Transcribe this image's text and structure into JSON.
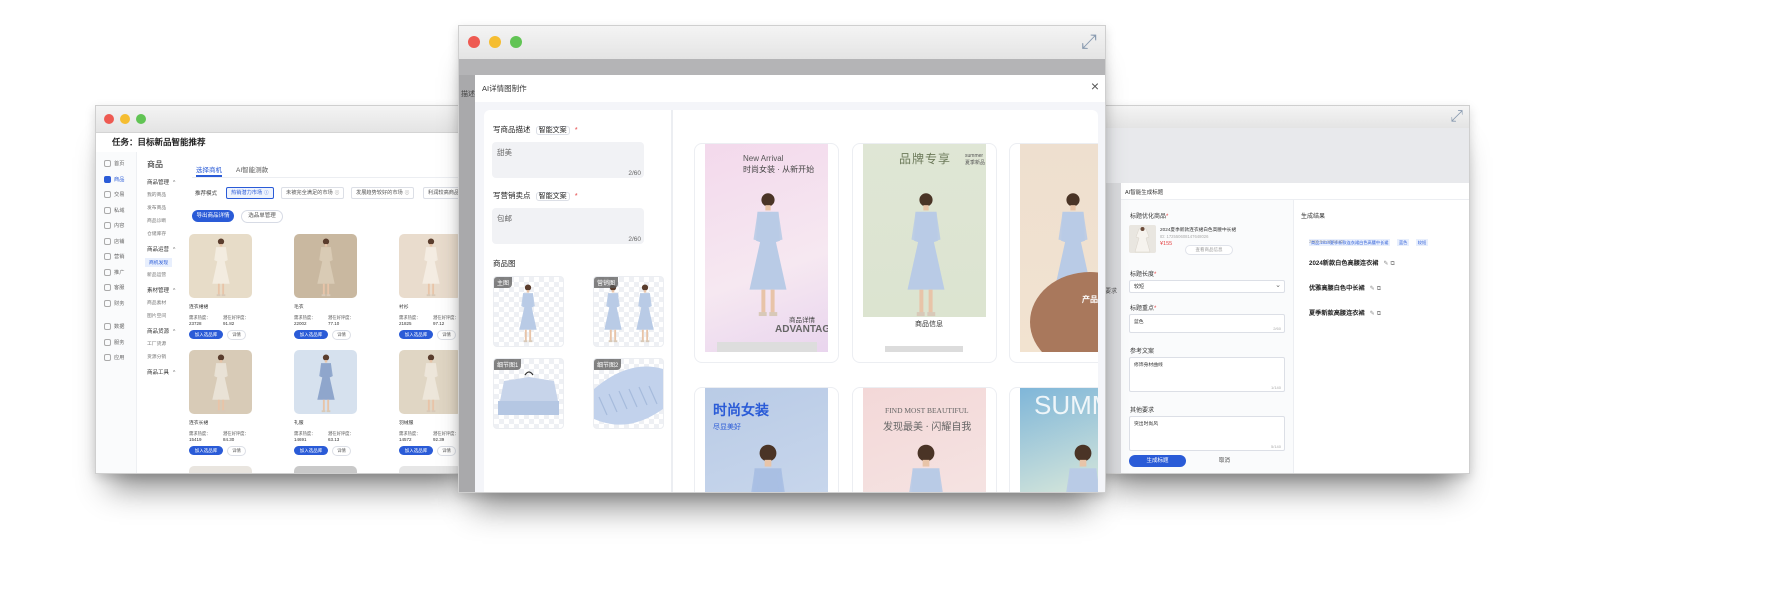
{
  "left_window": {
    "task_title": "任务：目标新品智能推荐",
    "sidebar": [
      "首页",
      "商品",
      "交易",
      "私域",
      "内容",
      "店铺",
      "营销",
      "推广",
      "客服",
      "财务",
      "数据",
      "服务",
      "应用"
    ],
    "nav_title": "商品",
    "nav_groups": [
      {
        "title": "商品管理",
        "items": [
          "我的商品",
          "发布商品",
          "商品诊断",
          "仓储库存"
        ]
      },
      {
        "title": "商品运营",
        "items": [
          "商机发现",
          "新品运营"
        ]
      },
      {
        "title": "素材管理",
        "items": [
          "商品素材",
          "图片空间"
        ]
      },
      {
        "title": "商品货源",
        "items": [
          "工厂货源",
          "货源分销"
        ]
      },
      {
        "title": "商品工具",
        "items": []
      }
    ],
    "tabs": [
      "选择商机",
      "AI智能测款"
    ],
    "filter_label": "推荐模式",
    "filters": [
      "热销潜力市场",
      "未被完全满足的市场",
      "发展趋势较好的市场",
      "利润较高商品"
    ],
    "primary_action": "导出商品详情",
    "secondary_action": "选品单管理",
    "products": [
      {
        "name": "连衣裙裙",
        "heat": "23728",
        "score": "91.82"
      },
      {
        "name": "毛衣",
        "heat": "22002",
        "score": "77.10"
      },
      {
        "name": "衬衫",
        "heat": "21825",
        "score": "97.12"
      },
      {
        "name": "连衣长裙",
        "heat": "15419",
        "score": "84.30"
      },
      {
        "name": "礼服",
        "heat": "14691",
        "score": "63.13"
      },
      {
        "name": "羽绒服",
        "heat": "14572",
        "score": "92.39"
      }
    ],
    "heat_label": "需求热度：",
    "score_label": "潜在好评度：",
    "add_label": "加入选品库",
    "detail_label": "详情"
  },
  "center_window": {
    "dialog_title": "AI详情图制作",
    "back_text": "描述",
    "desc_label": "写商品描述",
    "desc_ai": "智能文案",
    "desc_value": "甜美",
    "desc_count": "2/60",
    "selling_label": "写营销卖点",
    "selling_ai": "智能文案",
    "selling_value": "包邮",
    "selling_count": "2/60",
    "image_label": "商品图",
    "image_tags": [
      "主图",
      "营销图",
      "细节图1",
      "细节图2"
    ],
    "required_mark": "*",
    "close_icon": "×",
    "cards": [
      {
        "lines": [
          "New Arrival",
          "时尚女装 · 从新开始",
          "商品详情",
          "ADVANTAGE"
        ]
      },
      {
        "lines": [
          "品牌专享",
          "summer",
          "夏季新品",
          "商品信息",
          "甜美"
        ]
      },
      {
        "lines": [
          "夏",
          "产品信"
        ]
      },
      {
        "lines": [
          "时尚女装",
          "尽显美好"
        ]
      },
      {
        "lines": [
          "FIND MOST BEAUTIFUL",
          "发现最美 · 闪耀自我"
        ]
      },
      {
        "lines": [
          "SUMM"
        ]
      }
    ],
    "colors": {
      "accent": "#2a5bd7",
      "dialog_bg": "#f4f5f9"
    }
  },
  "right_window": {
    "dialog_title": "AI智能生成标题",
    "product_label": "标题优化商品",
    "product_name": "2024夏季新款连衣裙白色高腰中长裙",
    "product_id": "ID: 172550608147648026",
    "product_price": "¥155",
    "product_btn": "查看商品信息",
    "length_label": "标题长度",
    "length_value": "较短",
    "focus_label": "标题重点",
    "focus_value": "蓝色",
    "focus_count": "2/60",
    "ref_label": "参考文案",
    "ref_value": "修饰身材曲线",
    "ref_count": "1/140",
    "other_label": "其他要求",
    "other_value": "突出时尚风",
    "other_count": "5/140",
    "generate_label": "生成标题",
    "cancel_label": "取消",
    "result_label": "生成结果",
    "result_tags": [
      "商品:2024夏季新款连衣裙白色高腰中长裙",
      "蓝色",
      "较短"
    ],
    "result_time": "2024-9-5 15:14:42",
    "results": [
      "2024新款白色高腰连衣裙",
      "优雅高腰白色中长裙",
      "夏季新款高腰连衣裙"
    ],
    "side_text": "要求"
  }
}
